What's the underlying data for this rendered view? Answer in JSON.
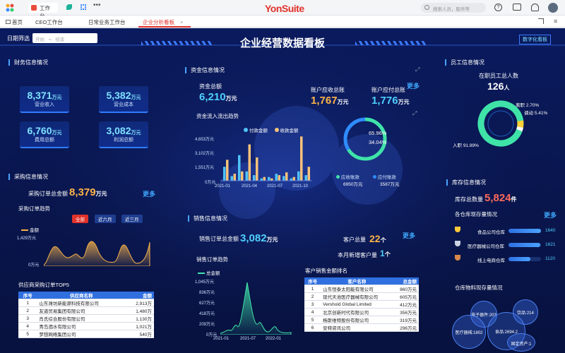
{
  "topbar": {
    "tab": "工作台",
    "logo": "YonSuite",
    "search_placeholder": "搜索人员，服务等"
  },
  "tabs": [
    {
      "label": "首页"
    },
    {
      "label": "CEO工作台"
    },
    {
      "label": "日常业务工作台"
    },
    {
      "label": "企业分析看板"
    }
  ],
  "header": {
    "title": "企业经营数据看板",
    "filter_label": "日期筛选",
    "date_start": "开始",
    "date_end": "结束",
    "brand": "数字化看板"
  },
  "finance": {
    "title": "财务信息情况",
    "items": [
      {
        "value": "8,371",
        "unit": "万元",
        "label": "营业收入"
      },
      {
        "value": "5,382",
        "unit": "万元",
        "label": "营业成本"
      },
      {
        "value": "6,760",
        "unit": "万元",
        "label": "费用总额"
      },
      {
        "value": "3,082",
        "unit": "万元",
        "label": "利润总额"
      }
    ]
  },
  "purchase": {
    "title": "采购信息情况",
    "total_label": "采购订单总金额",
    "total_value": "8,379",
    "total_unit": "万元",
    "more": "更多",
    "trend_title": "采购订单趋势",
    "tabs": [
      "全部",
      "近六月",
      "近三月"
    ],
    "legend": "金额",
    "ymax": "1,429万元",
    "ymin": "0万元",
    "x": [
      "2021-01",
      "2021-06",
      "2021-11",
      "2022-04"
    ]
  },
  "supplier": {
    "title": "供应商采购订单TOP5",
    "headers": [
      "序号",
      "供应商名称",
      "金额"
    ],
    "rows": [
      [
        "1",
        "山东潍坊新能源科技有限公司",
        "2,913万"
      ],
      [
        "2",
        "友道贸易集团有限公司",
        "1,480万"
      ],
      [
        "3",
        "肖氏综合股份有限公司",
        "1,130万"
      ],
      [
        "4",
        "青岛酒水有限公司",
        "1,021万"
      ],
      [
        "5",
        "梦想网络集团公司",
        "540万"
      ]
    ]
  },
  "funds": {
    "title": "资金信息情况",
    "total_label": "资金总额",
    "total_value": "6,210",
    "total_unit": "万元",
    "recv_label": "账户应收总账",
    "recv_value": "1,767",
    "recv_unit": "万元",
    "pay_label": "账户应付总账",
    "pay_value": "1,776",
    "pay_unit": "万元",
    "more": "更多",
    "flow_title": "资金流入流出趋势",
    "legend": [
      "付款金额",
      "收款金额"
    ],
    "y": [
      "4,653万元",
      "3,102万元",
      "1,551万元",
      "0万元"
    ],
    "x": [
      "2021-01",
      "2021-04",
      "2021-07",
      "2021-10"
    ],
    "ring_pct1": "65.96%",
    "ring_pct2": "34.04%",
    "ring_legend": [
      {
        "name": "应收账款",
        "value": "6950万元"
      },
      {
        "name": "应付账款",
        "value": "3587万元"
      }
    ]
  },
  "sales": {
    "title": "销售信息情况",
    "total_label": "销售订单总金额",
    "total_value": "3,082",
    "total_unit": "万元",
    "cust_label": "客户总量",
    "cust_value": "22",
    "cust_unit": "个",
    "new_label": "本月新增客户量",
    "new_value": "1",
    "new_unit": "个",
    "more": "更多",
    "trend_title": "销售订单趋势",
    "legend": "总金额",
    "y": [
      "1,045万元",
      "836万元",
      "627万元",
      "418万元",
      "209万元",
      "0万元"
    ],
    "x": [
      "2021-01",
      "2021-07",
      "2022-01"
    ],
    "rank_title": "客户销售金额排名",
    "headers": [
      "序号",
      "客户名称",
      "总金额"
    ],
    "rows": [
      [
        "1",
        "山东恒泰太阳能有限公司",
        "860万元"
      ],
      [
        "2",
        "现代天池医疗器械有限公司",
        "605万元"
      ],
      [
        "3",
        "Vershold Global Limited",
        "412万元"
      ],
      [
        "4",
        "北京创新时代有限公司",
        "356万元"
      ],
      [
        "5",
        "杨斯维特股份有限公司",
        "319万元"
      ],
      [
        "6",
        "安特资讯公司",
        "296万元"
      ]
    ]
  },
  "staff": {
    "title": "员工信息情况",
    "count_label": "在职员工总人数",
    "count_value": "126",
    "count_unit": "人",
    "ring": [
      {
        "label": "离职",
        "pct": "2.70%",
        "color": "#ffffff"
      },
      {
        "label": "调动",
        "pct": "5.41%",
        "color": "#ffd23a"
      },
      {
        "label": "入职",
        "pct": "91.89%",
        "color": "#3fe3a8"
      }
    ]
  },
  "stock": {
    "title": "库存信息情况",
    "total_label": "库存总数量",
    "total_value": "5,824",
    "total_unit": "件",
    "wh_title": "各仓库现存量情况",
    "more": "更多",
    "warehouses": [
      {
        "name": "食品公司仓库",
        "value": "1640",
        "pct": 100
      },
      {
        "name": "医疗器械公司仓库",
        "value": "1621",
        "pct": 98
      },
      {
        "name": "线上电商仓库",
        "value": "1120",
        "pct": 68
      }
    ],
    "cat_title": "仓库物料现存量情况",
    "bubbles": [
      "电子器件:203",
      "饮品:214",
      "医疗器械:1802",
      "食品:2694.2",
      "固定资产:1"
    ]
  }
}
